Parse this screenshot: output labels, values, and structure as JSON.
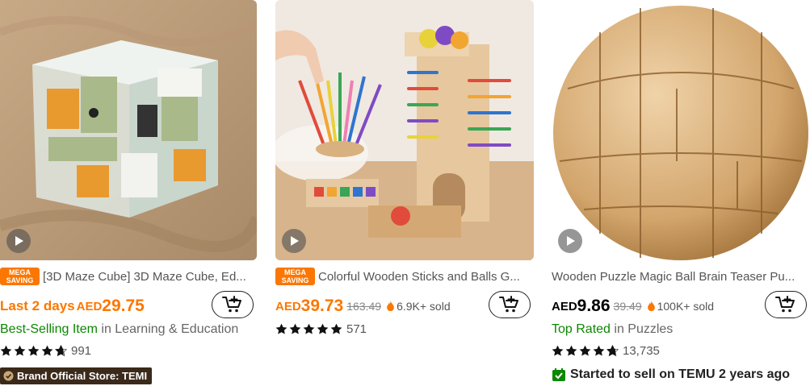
{
  "products": [
    {
      "badge": "MEGA SAVING",
      "title": "[3D Maze Cube] 3D Maze Cube, Ed...",
      "promo": "Last 2 days",
      "currency": "AED",
      "price": "29.75",
      "category_label": "Best-Selling Item",
      "category_sep": " in ",
      "category": "Learning & Education",
      "rating_count": "991",
      "store_badge": "Brand Official Store: TEMI"
    },
    {
      "badge": "MEGA SAVING",
      "title": "Colorful Wooden Sticks and Balls G...",
      "currency": "AED",
      "price": "39.73",
      "original_price": "163.49",
      "sold": "6.9K+ sold",
      "rating_count": "571"
    },
    {
      "title": "Wooden Puzzle Magic Ball Brain Teaser Pu...",
      "currency": "AED",
      "price": "9.86",
      "original_price": "39.49",
      "sold": "100K+ sold",
      "category_label": "Top Rated",
      "category_sep": " in ",
      "category": "Puzzles",
      "rating_count": "13,735",
      "seller_note": "Started to sell on TEMU 2 years ago"
    }
  ],
  "badge_line1": "MEGA",
  "badge_line2": "SAVING",
  "colors": {
    "accent": "#fb7701",
    "green": "#0a8800",
    "store_badge_bg": "#3b2a1a"
  },
  "icons": [
    "play-icon",
    "cart-add-icon",
    "fire-icon",
    "star-icon",
    "verified-icon",
    "check-badge-icon"
  ]
}
